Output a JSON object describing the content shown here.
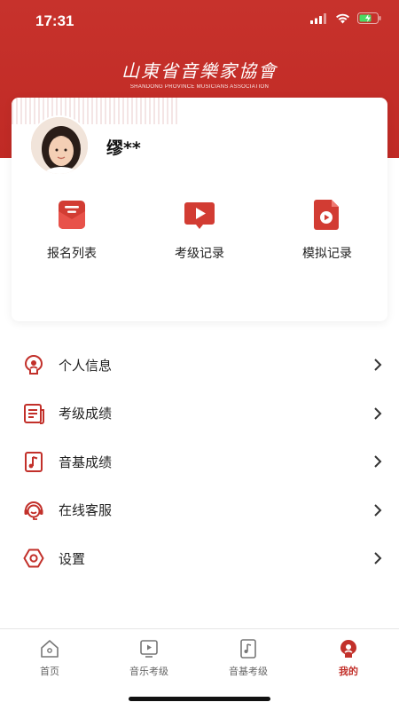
{
  "status_bar": {
    "time": "17:31"
  },
  "logo": {
    "title_cn": "山東省音樂家協會",
    "title_en": "SHANDONG PROVINCE MUSICIANS ASSOCIATION"
  },
  "profile": {
    "username": "缪**"
  },
  "quick_actions": [
    {
      "label": "报名列表",
      "icon": "registration-envelope-icon"
    },
    {
      "label": "考级记录",
      "icon": "exam-play-icon"
    },
    {
      "label": "模拟记录",
      "icon": "mock-file-icon"
    }
  ],
  "menu": [
    {
      "label": "个人信息",
      "icon": "user-info-icon"
    },
    {
      "label": "考级成绩",
      "icon": "exam-score-icon"
    },
    {
      "label": "音基成绩",
      "icon": "music-theory-score-icon"
    },
    {
      "label": "在线客服",
      "icon": "customer-service-icon"
    },
    {
      "label": "设置",
      "icon": "settings-icon"
    }
  ],
  "tabbar": [
    {
      "label": "首页",
      "icon": "home-icon",
      "active": false
    },
    {
      "label": "音乐考级",
      "icon": "music-exam-icon",
      "active": false
    },
    {
      "label": "音基考级",
      "icon": "music-theory-exam-icon",
      "active": false
    },
    {
      "label": "我的",
      "icon": "profile-icon",
      "active": true
    }
  ],
  "colors": {
    "brand_red": "#c2302a",
    "text": "#222222",
    "tab_inactive": "#666666"
  }
}
